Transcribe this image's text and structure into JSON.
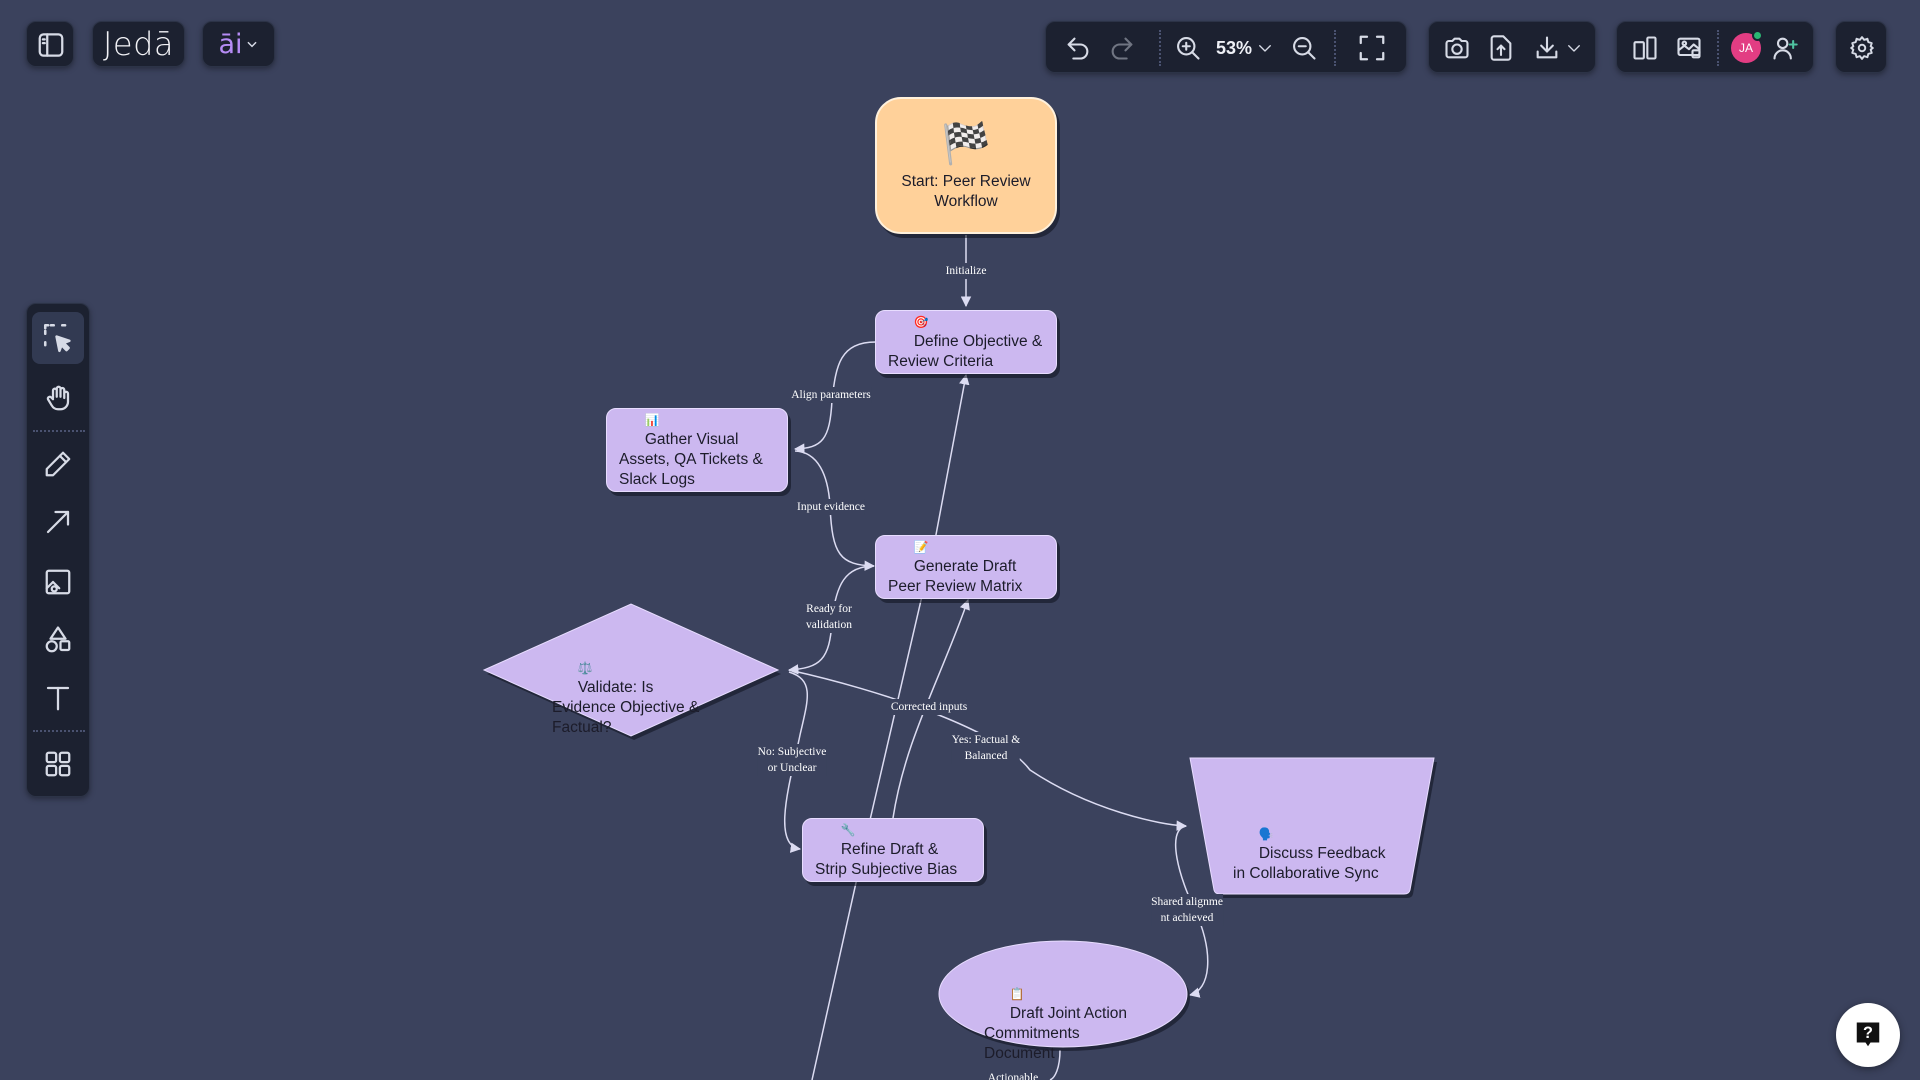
{
  "app": {
    "logo_text": "Jedā",
    "ai_label": "āi"
  },
  "toolbar": {
    "zoom_level": "53%",
    "user_initials": "JA"
  },
  "icons": {
    "sidebar_toggle": "sidebar-toggle-icon",
    "undo": "undo-icon",
    "redo": "redo-icon",
    "zoom_in": "zoom-in-icon",
    "zoom_out": "zoom-out-icon",
    "fit": "fullscreen-icon",
    "camera": "camera-icon",
    "upload": "upload-icon",
    "download": "download-icon",
    "panel_layout": "panel-layout-icon",
    "present": "present-icon",
    "invite": "add-user-icon",
    "settings": "gear-icon",
    "help": "help-icon"
  },
  "tools": [
    "select-tool",
    "hand-tool",
    "pencil-tool",
    "arrow-tool",
    "image-tool",
    "shapes-tool",
    "text-tool",
    "components-tool"
  ],
  "colors": {
    "canvas": "#3b425d",
    "node_fill": "#ccb8f0",
    "start_fill": "#ffd19a",
    "edge": "#dcdcf2",
    "avatar": "#e23d83",
    "presence": "#2bb673"
  },
  "diagram": {
    "nodes": {
      "start": {
        "emoji": "🏁",
        "label": "Start: Peer Review\nWorkflow"
      },
      "define": {
        "emoji": "🎯",
        "label": "Define Objective &\nReview Criteria"
      },
      "gather": {
        "emoji": "📊",
        "label": "Gather Visual\nAssets, QA Tickets &\nSlack Logs"
      },
      "generate": {
        "emoji": "📝",
        "label": "Generate Draft\nPeer Review Matrix"
      },
      "validate": {
        "emoji": "⚖️",
        "label": "Validate: Is\nEvidence Objective &\nFactual?"
      },
      "refine": {
        "emoji": "🔧",
        "label": "Refine Draft &\nStrip Subjective Bias"
      },
      "discuss": {
        "emoji": "🗣️",
        "label": "Discuss Feedback\nin Collaborative Sync"
      },
      "draft": {
        "emoji": "📋",
        "label": "Draft Joint Action\nCommitments\nDocument"
      }
    },
    "edges": {
      "initialize": "Initialize",
      "align": "Align parameters",
      "input_evidence": "Input evidence",
      "ready": "Ready for\nvalidation",
      "corrected": "Corrected inputs",
      "yes": "Yes: Factual &\nBalanced",
      "no": "No: Subjective\nor Unclear",
      "shared": "Shared alignme\nnt achieved",
      "actionable": "Actionable"
    }
  }
}
